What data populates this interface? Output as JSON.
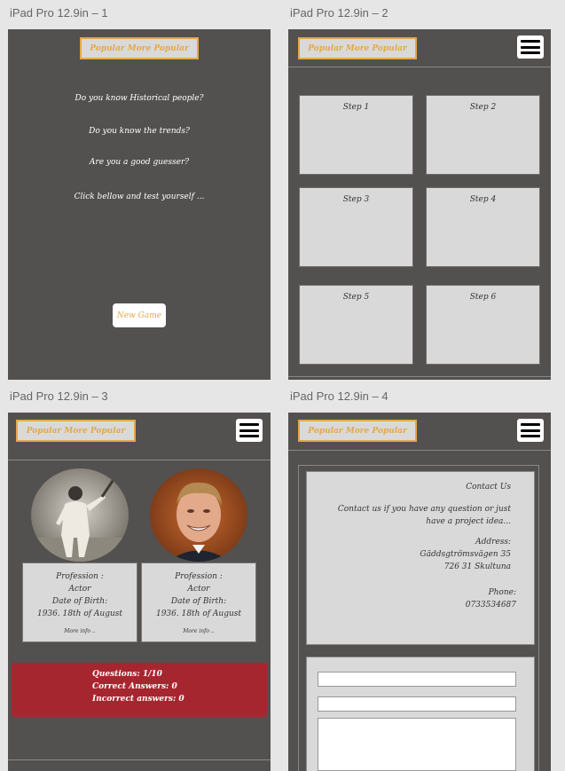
{
  "artboards": {
    "a1": {
      "label": "iPad Pro 12.9in – 1"
    },
    "a2": {
      "label": "iPad Pro 12.9in – 2"
    },
    "a3": {
      "label": "iPad Pro 12.9in – 3"
    },
    "a4": {
      "label": "iPad Pro 12.9in – 4"
    }
  },
  "brand_button": "Popular More Popular",
  "home": {
    "questions": [
      "Do you know Historical people?",
      "Do you know the trends?",
      "Are you a good guesser?",
      "Click bellow and test yourself ..."
    ],
    "new_game": "New Game"
  },
  "steps": [
    "Step 1",
    "Step 2",
    "Step 3",
    "Step 4",
    "Step 5",
    "Step 6"
  ],
  "game": {
    "cards": [
      {
        "profession_label": "Profession :",
        "profession": "Actor",
        "dob_label": "Date of Birth:",
        "dob": "1936. 18th of August",
        "more": "More info .."
      },
      {
        "profession_label": "Profession :",
        "profession": "Actor",
        "dob_label": "Date of Birth:",
        "dob": "1936. 18th of August",
        "more": "More info .."
      }
    ],
    "score": {
      "questions": "Questions: 1/10",
      "correct": "Correct Answers: 0",
      "incorrect": "Incorrect answers: 0"
    }
  },
  "contact": {
    "title": "Contact Us",
    "intro_1": "Contact us if you have any question or just",
    "intro_2": "have a project idea...",
    "address_label": "Address:",
    "address_1": "Gäddsgtrömsvägen 35",
    "address_2": "726 31 Skultuna",
    "phone_label": "Phone:",
    "phone": "0733534687"
  },
  "colors": {
    "accent": "#e3a84a",
    "board": "#535050",
    "score_bg": "#a6262f"
  }
}
